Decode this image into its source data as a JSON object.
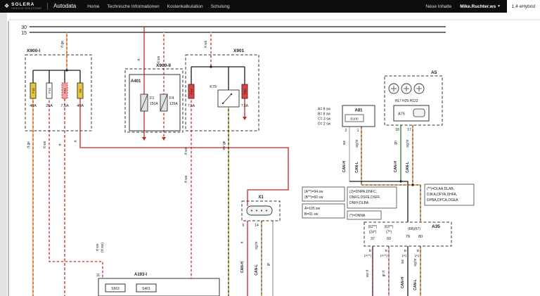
{
  "navbar": {
    "brand": "SOLERA",
    "brand_sub": "VEHICLE SOLUTIONS",
    "product": "Autodata",
    "items": [
      "Home",
      "Technische Informationen",
      "Kostenkalkulation",
      "Schulung"
    ],
    "new_content": "Neue Inhalte",
    "user": "Mike.Ruchter.ws",
    "vehicle": "1.4 eHybrid"
  },
  "colors": {
    "navbar_bg": "#0d0d0d",
    "wire_red": "#c62828",
    "wire_yellow": "#e6c832",
    "wire_green": "#2e7d32",
    "wire_orange": "#d9822b",
    "wire_brown": "#6d4c41",
    "wire_gray": "#9e9e9e",
    "wire_black": "#1a1a1a",
    "fuse_yellow": "#e8c53a",
    "fuse_red": "#d64545"
  },
  "labels": {
    "rail30": "30",
    "rail15": "15",
    "x900i": "X900-I",
    "x900ii": "X900-II",
    "a401": "A401",
    "x901": "X901",
    "k79": "K79",
    "x1": "X1",
    "a193i": "A193-I",
    "a81": "A81",
    "a5": "A5",
    "a75": "A75",
    "a35": "A35",
    "b100": "B100",
    "s563": "S563",
    "s401": "S401",
    "f15": "F15",
    "f15_a": "40A",
    "f13": "F13",
    "f13_a": "25A",
    "f21": "F21",
    "f21_a": "7,5A",
    "f8": "F8",
    "f8_a": "40A",
    "f1": "F1",
    "f1_a": "150A",
    "f4": "F4",
    "f4_a": "125A",
    "f44": "F44",
    "f44_a": "7,5A",
    "f50": "F50",
    "f50_a": "7,5A",
    "h_units": "H17 H29 H122",
    "conn_a": "A= 8 sw",
    "conn_b": "B= 8 sw",
    "conn_c": "C= 3 sw",
    "conn_d": "D= 2 sw",
    "pin1": "1",
    "pin2": "2",
    "pin17": "17",
    "pin18": "18",
    "pin6": "6",
    "pin14": "14",
    "pin11": "11",
    "note1_l1": "(A**)=94 sw",
    "note1_l2": "(B**)=60 sw",
    "note2_l1": "(J)=DNPA,DNFC,",
    "note2_l2": "DNFG,DSFE,DSFF,",
    "note2_l3": "DNFF,DLBA",
    "note3_l1": "A=105 sw",
    "note3_l2": "B=91 sw",
    "note4": "(*)=DNNA",
    "note5_l1": "(**)=DLAA,DLAB,",
    "note5_l2": "DJKA,DFYA,DHFA,",
    "note5_l3": "DPBA,DPCA,DGEA",
    "p62": "(62**)",
    "p24": "(24*)",
    "p37": "37",
    "p63": "(63**)",
    "p7": "(7*)",
    "p60": "60",
    "p6867": "(68)(67)",
    "p79": "79",
    "p80": "80",
    "t_b": "B",
    "t_a2star": "(A**)",
    "t_a": "(A)",
    "w_rtge": "rt ge",
    "w_rtws": "rt ws",
    "w_rt": "rt",
    "w_rtsw_var": "(rt sw)",
    "w_swge": "sw ge",
    "w_ws": "ws",
    "w_gn": "gn",
    "w_ogbr": "og br",
    "w_gr": "gr",
    "w_sw": "sw",
    "w_swrt": "sw rt",
    "w_grrt": "gr rt",
    "can_h": "CAN-H",
    "can_l": "CAN-L"
  }
}
